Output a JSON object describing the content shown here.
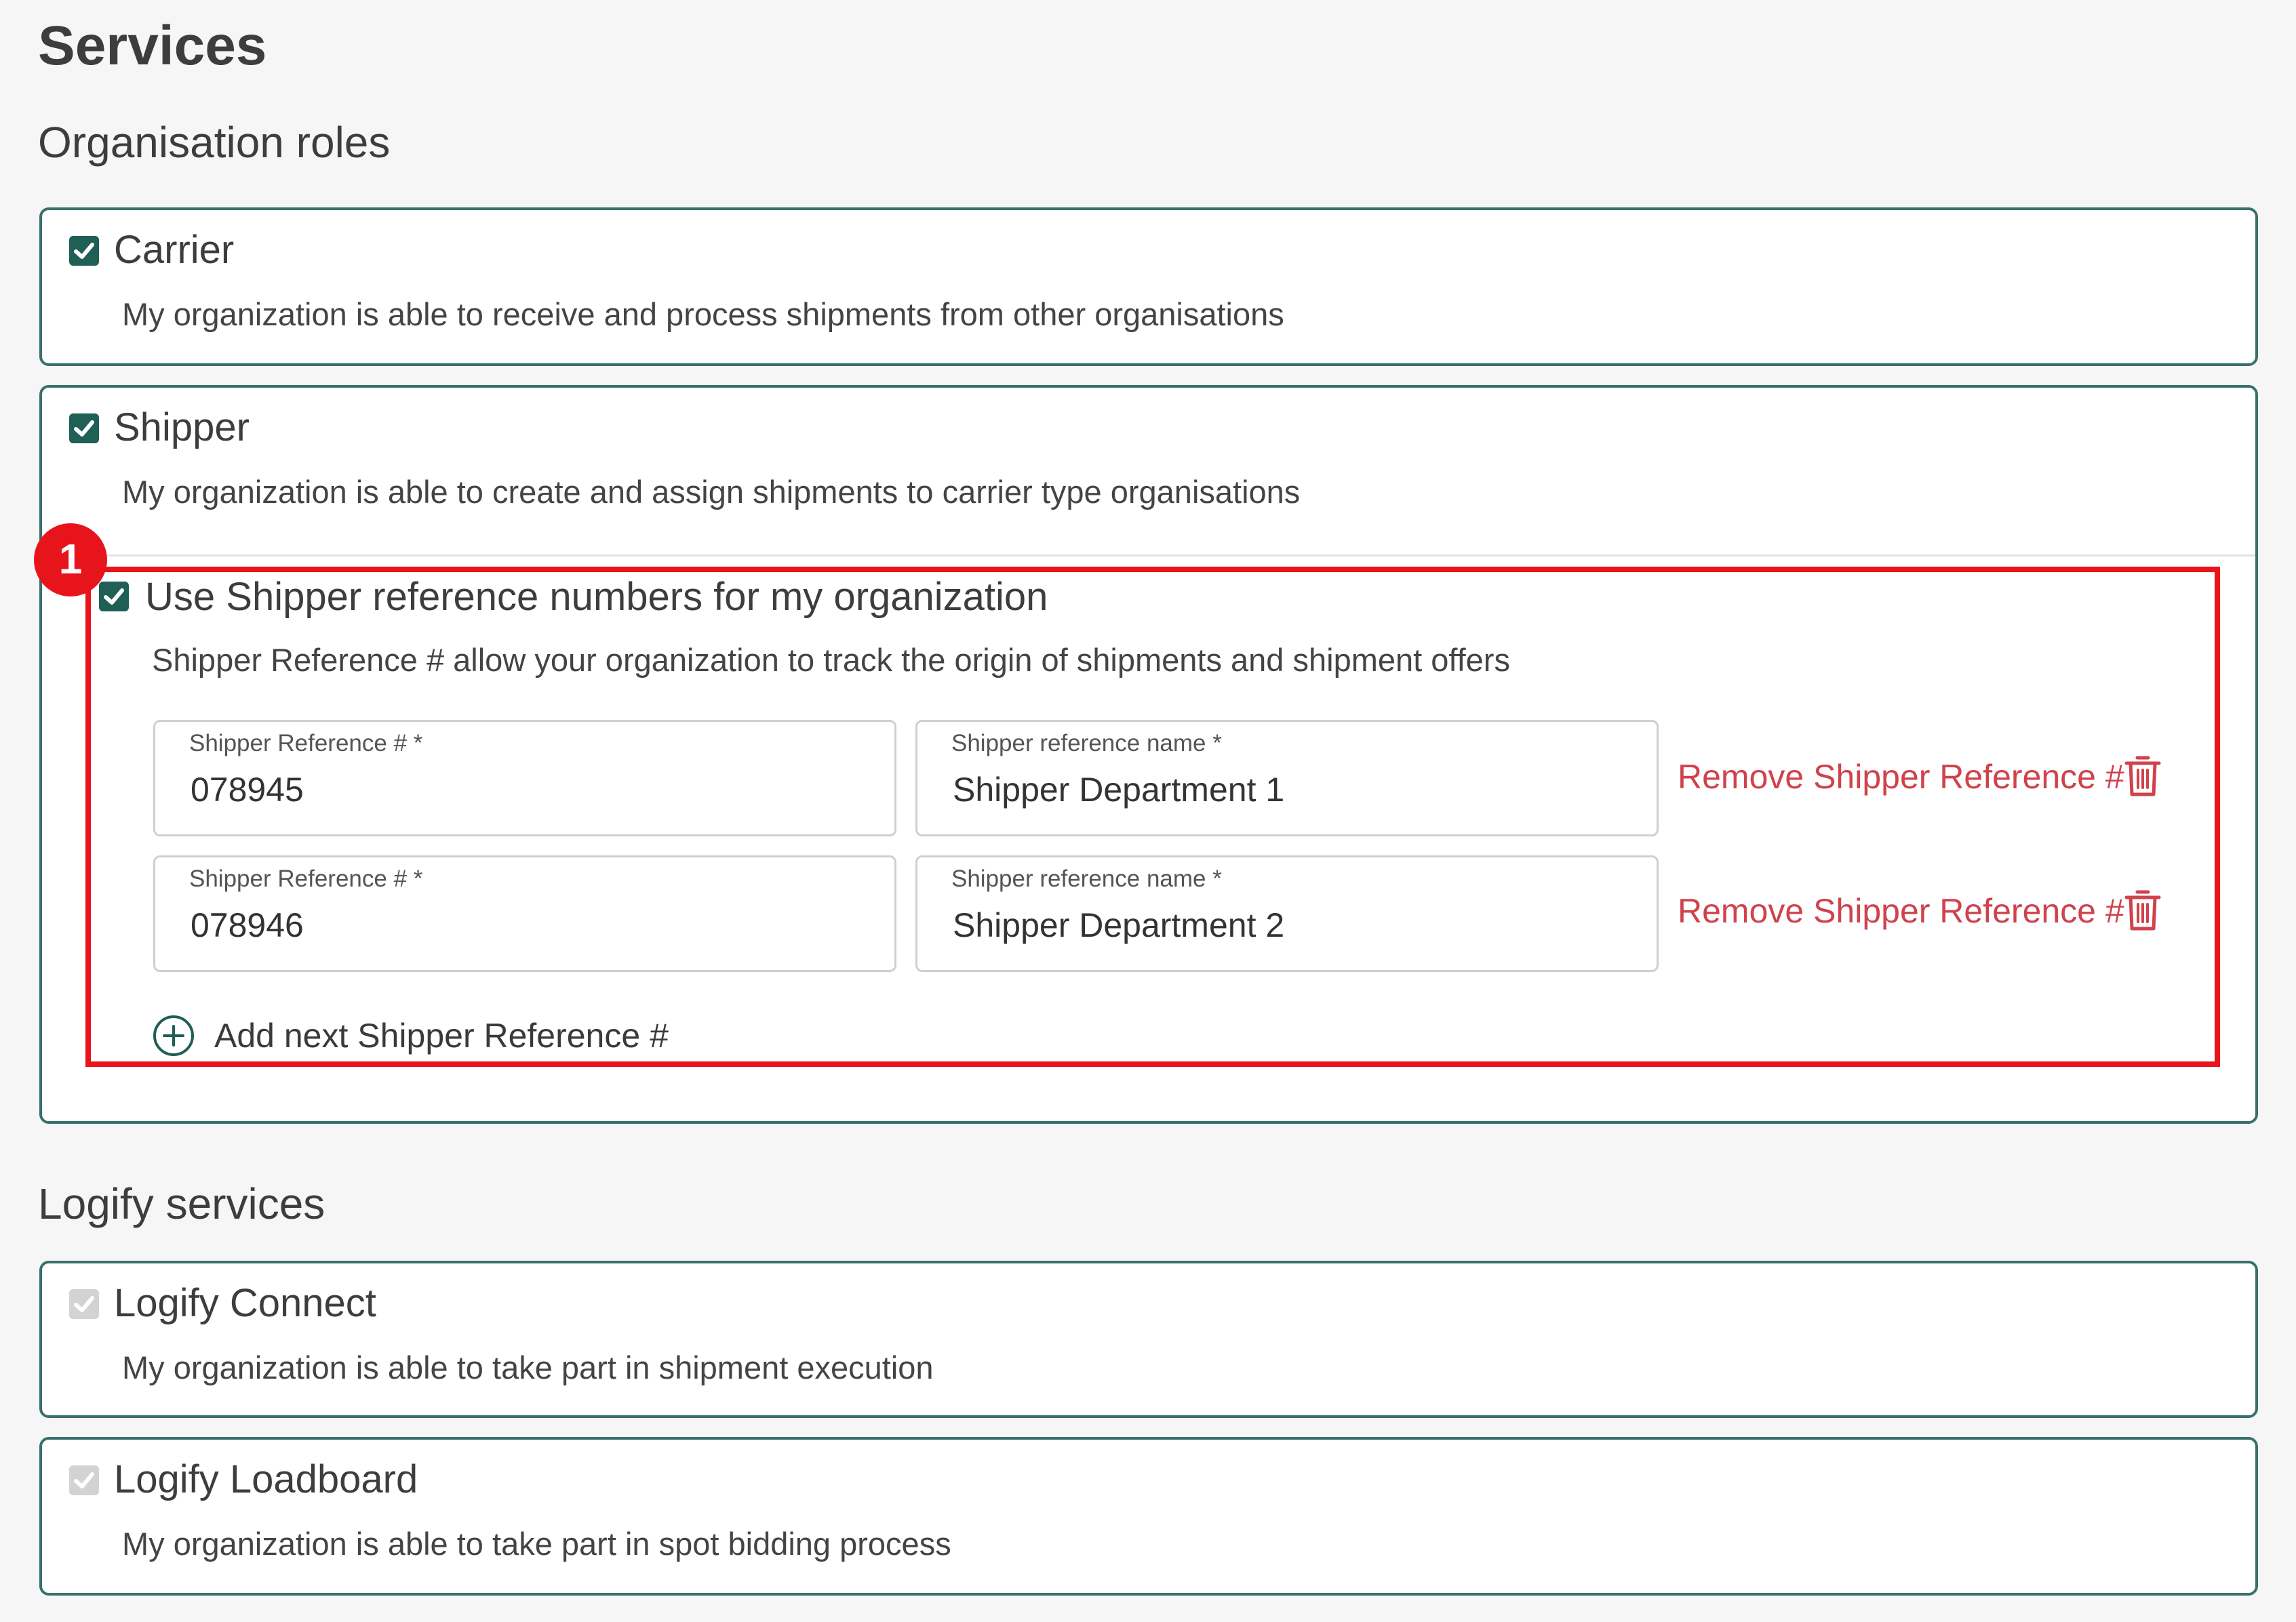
{
  "page": {
    "title": "Services"
  },
  "organisation_roles": {
    "heading": "Organisation roles",
    "carrier": {
      "label": "Carrier",
      "description": "My organization is able to receive and process shipments from other organisations",
      "checked": true
    },
    "shipper": {
      "label": "Shipper",
      "description": "My organization is able to create and assign shipments to carrier type organisations",
      "checked": true,
      "reference_numbers": {
        "badge": "1",
        "label": "Use Shipper reference numbers for my organization",
        "description": "Shipper Reference # allow your organization to track the origin of shipments and shipment offers",
        "checked": true,
        "rows": [
          {
            "ref_label": "Shipper Reference # *",
            "ref_value": "078945",
            "name_label": "Shipper reference name *",
            "name_value": "Shipper Department 1",
            "remove_label": "Remove Shipper Reference #"
          },
          {
            "ref_label": "Shipper Reference # *",
            "ref_value": "078946",
            "name_label": "Shipper reference name *",
            "name_value": "Shipper Department 2",
            "remove_label": "Remove Shipper Reference #"
          }
        ],
        "add_label": "Add next Shipper Reference #"
      }
    }
  },
  "logify_services": {
    "heading": "Logify services",
    "connect": {
      "label": "Logify Connect",
      "description": "My organization is able to take part in shipment execution",
      "checked": true,
      "disabled": true
    },
    "loadboard": {
      "label": "Logify Loadboard",
      "description": "My organization is able to take part in spot bidding process",
      "checked": true,
      "disabled": true
    }
  },
  "colors": {
    "accent": "#1f5f56",
    "card_border": "#39706a",
    "highlight": "#e8141c",
    "remove_link": "#d0424c",
    "disabled_checkbox": "#d3d3d3"
  },
  "icons": {
    "checkbox": "check-icon",
    "remove": "trash-icon",
    "add": "plus-circle-icon"
  }
}
